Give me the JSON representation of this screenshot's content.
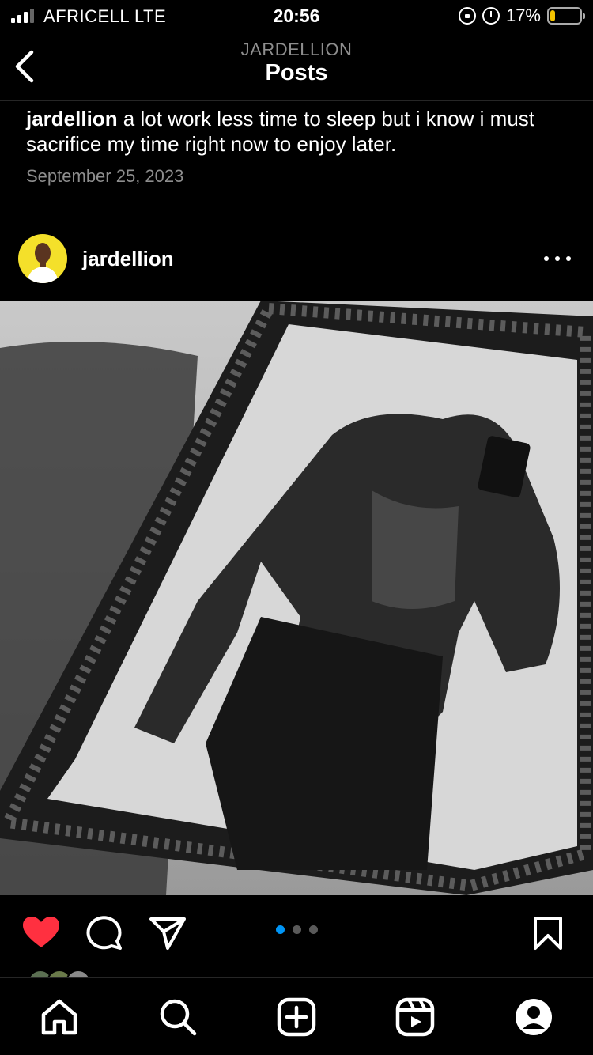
{
  "status_bar": {
    "carrier": "AFRICELL  LTE",
    "time": "20:56",
    "battery_text": "17%",
    "battery_level": 0.17,
    "battery_color": "#f5c400"
  },
  "header": {
    "account": "JARDELLION",
    "title": "Posts"
  },
  "caption": {
    "username": "jardellion",
    "text": " a lot work less time to sleep but i know i must sacrifice my time right now to enjoy later.",
    "date": "September 25, 2023"
  },
  "post": {
    "username": "jardellion",
    "image_alt": "Black-and-white mirror selfie in an ornate frame",
    "carousel": {
      "count": 3,
      "active_index": 0,
      "active_color": "#0095f6"
    },
    "liked": true,
    "like_color": "#ff3040"
  },
  "icons": {
    "back": "chevron-left-icon",
    "more": "more-horizontal-icon",
    "like": "heart-icon",
    "comment": "comment-icon",
    "share": "send-icon",
    "save": "bookmark-icon",
    "home": "home-icon",
    "search": "search-icon",
    "create": "plus-square-icon",
    "reels": "reels-icon",
    "profile": "profile-icon"
  }
}
